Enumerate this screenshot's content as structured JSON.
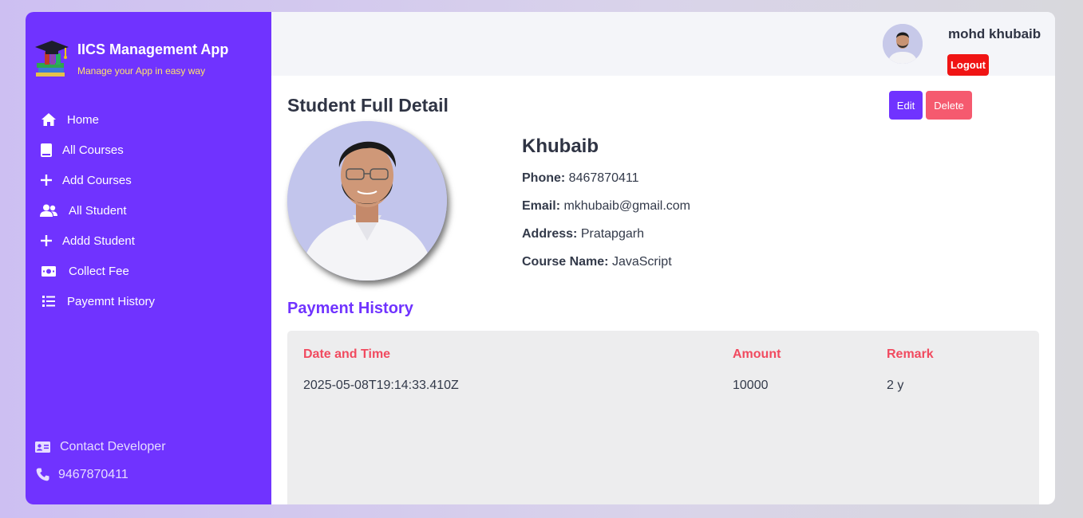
{
  "brand": {
    "title": "IICS Management App",
    "tagline": "Manage your App in easy way"
  },
  "nav": [
    {
      "label": "Home",
      "icon": "home-icon"
    },
    {
      "label": "All Courses",
      "icon": "book-icon"
    },
    {
      "label": "Add Courses",
      "icon": "plus-icon"
    },
    {
      "label": "All Student",
      "icon": "users-icon"
    },
    {
      "label": "Addd Student",
      "icon": "plus-icon"
    },
    {
      "label": "Collect Fee",
      "icon": "money-icon"
    },
    {
      "label": "Payemnt History",
      "icon": "list-icon"
    }
  ],
  "sidebar_footer": {
    "contact_label": "Contact Developer",
    "phone": "9467870411"
  },
  "header": {
    "user_name": "mohd khubaib",
    "logout_label": "Logout"
  },
  "page": {
    "title": "Student Full Detail",
    "edit_label": "Edit",
    "delete_label": "Delete"
  },
  "student": {
    "name": "Khubaib",
    "phone_label": "Phone:",
    "phone": "8467870411",
    "email_label": "Email:",
    "email": "mkhubaib@gmail.com",
    "address_label": "Address:",
    "address": "Pratapgarh",
    "course_label": "Course Name:",
    "course": "JavaScript"
  },
  "payment": {
    "title": "Payment History",
    "columns": [
      "Date and Time",
      "Amount",
      "Remark"
    ],
    "rows": [
      [
        "2025-05-08T19:14:33.410Z",
        "10000",
        "2 y"
      ]
    ]
  },
  "colors": {
    "primary": "#7033ff",
    "danger": "#f55a6f",
    "logout": "#f01414",
    "table_header": "#f14a5f"
  }
}
